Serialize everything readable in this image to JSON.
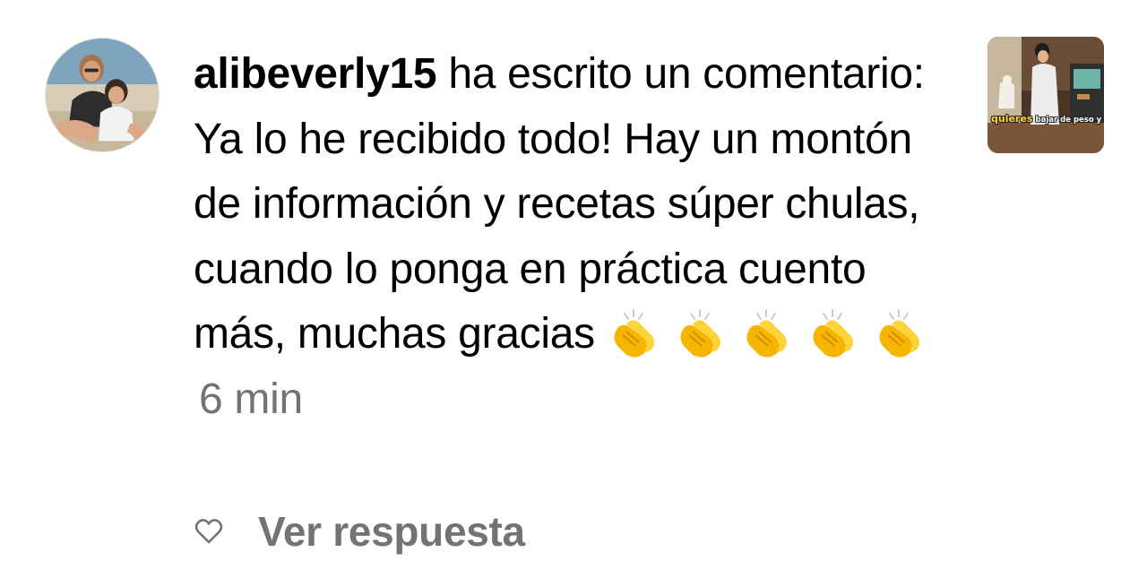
{
  "comment": {
    "avatar_icon": "user-avatar-photo",
    "username": "alibeverly15",
    "text": " ha escrito un comentario: Ya lo he recibido todo! Hay un montón de información y recetas súper chulas, cuando lo ponga en práctica cuento más, muchas gracias",
    "emoji": [
      "👏",
      "👏",
      "👏",
      "👏",
      "👏"
    ],
    "emoji_icon": "clapping-hands-icon",
    "timestamp": "6 min"
  },
  "actions": {
    "like_icon": "heart-outline-icon",
    "reply_label": "Ver respuesta"
  },
  "post_thumbnail": {
    "caption_highlight": "quieres",
    "caption_rest": "bajar de peso y"
  },
  "colors": {
    "text": "#000000",
    "secondary_text": "#737373",
    "caption_highlight": "#ffd92e"
  }
}
